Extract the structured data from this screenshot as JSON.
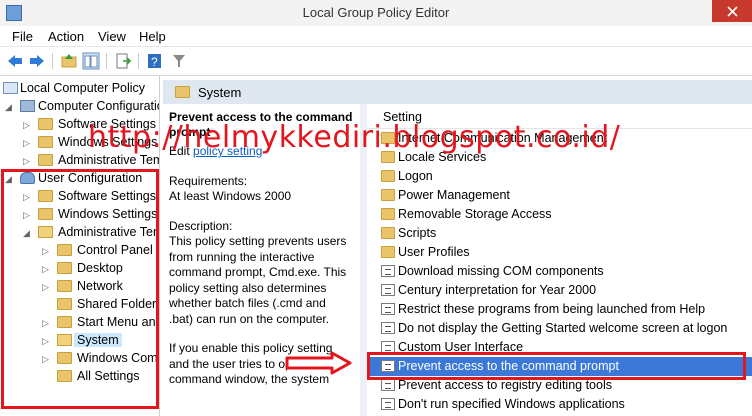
{
  "window": {
    "title": "Local Group Policy Editor"
  },
  "menu": [
    "File",
    "Action",
    "View",
    "Help"
  ],
  "tree": {
    "root": "Local Computer Policy",
    "computer_config": "Computer Configuration",
    "cc_children": [
      "Software Settings",
      "Windows Settings",
      "Administrative Templates"
    ],
    "user_config": "User Configuration",
    "uc_children": [
      "Software Settings",
      "Windows Settings",
      "Administrative Templates"
    ],
    "admin_children": [
      "Control Panel",
      "Desktop",
      "Network",
      "Shared Folders",
      "Start Menu and Taskbar",
      "System",
      "Windows Components",
      "All Settings"
    ]
  },
  "header": {
    "folder": "System"
  },
  "description": {
    "heading": "Prevent access to the command prompt",
    "edit_prefix": "Edit",
    "edit_link": "policy setting",
    "requirements_label": "Requirements:",
    "requirements_value": "At least Windows 2000",
    "description_label": "Description:",
    "description_text": "This policy setting prevents users from running the interactive command prompt, Cmd.exe.  This policy setting also determines whether batch files (.cmd and .bat) can run on the computer.",
    "extra_text": "If you enable this policy setting and the user tries to open a command window, the system"
  },
  "list": {
    "column": "Setting",
    "items": [
      {
        "label": "Internet Communication Management",
        "kind": "folder"
      },
      {
        "label": "Locale Services",
        "kind": "folder"
      },
      {
        "label": "Logon",
        "kind": "folder"
      },
      {
        "label": "Power Management",
        "kind": "folder"
      },
      {
        "label": "Removable Storage Access",
        "kind": "folder"
      },
      {
        "label": "Scripts",
        "kind": "folder"
      },
      {
        "label": "User Profiles",
        "kind": "folder"
      },
      {
        "label": "Download missing COM components",
        "kind": "setting"
      },
      {
        "label": "Century interpretation for Year 2000",
        "kind": "setting"
      },
      {
        "label": "Restrict these programs from being launched from Help",
        "kind": "setting"
      },
      {
        "label": "Do not display the Getting Started welcome screen at logon",
        "kind": "setting"
      },
      {
        "label": "Custom User Interface",
        "kind": "setting"
      },
      {
        "label": "Prevent access to the command prompt",
        "kind": "setting",
        "selected": true
      },
      {
        "label": "Prevent access to registry editing tools",
        "kind": "setting"
      },
      {
        "label": "Don't run specified Windows applications",
        "kind": "setting"
      }
    ]
  },
  "watermark": "http://helmykkediri.blogspot.co.id/",
  "colors": {
    "accent": "#3b78d8",
    "highlight": "#e3151d",
    "header": "#dfe7f1"
  }
}
